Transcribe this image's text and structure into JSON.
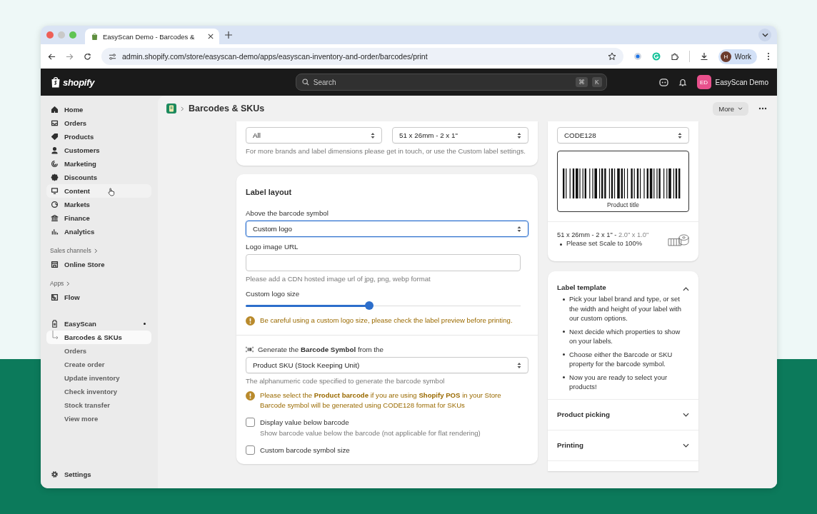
{
  "browser": {
    "tab_title": "EasyScan Demo - Barcodes &",
    "url": "admin.shopify.com/store/easyscan-demo/apps/easyscan-inventory-and-order/barcodes/print",
    "profile": {
      "initial": "H",
      "label": "Work"
    }
  },
  "topbar": {
    "logo_text": "shopify",
    "search": {
      "placeholder": "Search",
      "keys": [
        "⌘",
        "K"
      ]
    },
    "store": {
      "initials": "ED",
      "name": "EasyScan Demo"
    }
  },
  "sidebar": {
    "main_items": [
      {
        "label": "Home",
        "hovered": false
      },
      {
        "label": "Orders",
        "hovered": false
      },
      {
        "label": "Products",
        "hovered": false
      },
      {
        "label": "Customers",
        "hovered": false
      },
      {
        "label": "Marketing",
        "hovered": false
      },
      {
        "label": "Discounts",
        "hovered": false
      },
      {
        "label": "Content",
        "hovered": true
      },
      {
        "label": "Markets",
        "hovered": false
      },
      {
        "label": "Finance",
        "hovered": false
      },
      {
        "label": "Analytics",
        "hovered": false
      }
    ],
    "sales_channels": {
      "label": "Sales channels",
      "items": [
        {
          "label": "Online Store"
        }
      ]
    },
    "apps": {
      "label": "Apps",
      "items": [
        {
          "label": "Flow"
        }
      ]
    },
    "app": {
      "label": "EasyScan",
      "children": [
        {
          "label": "Barcodes & SKUs",
          "selected": true
        },
        {
          "label": "Orders",
          "selected": false
        },
        {
          "label": "Create order",
          "selected": false
        },
        {
          "label": "Update inventory",
          "selected": false
        },
        {
          "label": "Check inventory",
          "selected": false
        },
        {
          "label": "Stock transfer",
          "selected": false
        },
        {
          "label": "View more",
          "selected": false
        }
      ]
    },
    "settings": "Settings"
  },
  "page": {
    "title": "Barcodes & SKUs",
    "more": "More"
  },
  "label_stock": {
    "brand_select": {
      "value": "All",
      "focused": false
    },
    "size_select": {
      "value": "51 x 26mm - 2 x 1\"",
      "focused": false
    },
    "help": "For more brands and label dimensions please get in touch, or use the Custom label settings."
  },
  "label_layout": {
    "title": "Label layout",
    "above_label": "Above the barcode symbol",
    "above_select": {
      "value": "Custom logo",
      "focused": true
    },
    "logo_url_label": "Logo image URL",
    "logo_url_help": "Please add a CDN hosted image url of jpg, png, webp format",
    "logo_size_label": "Custom logo size",
    "logo_size": {
      "level": 0.45
    },
    "warning": "Be careful using a custom logo size, please check the label preview before printing."
  },
  "barcode_symbol": {
    "label": "Generate the **Barcode Symbol** from the",
    "select": {
      "value": "Product SKU (Stock Keeping Unit)",
      "focused": false
    },
    "help": "The alphanumeric code specified to generate the barcode symbol",
    "warnings": [
      "Please select the **Product barcode** if you are using **Shopify POS** in your Store",
      "Barcode symbol will be generated using CODE128 format for SKUs"
    ],
    "options": [
      {
        "label": "Display value below barcode",
        "description": "Show barcode value below the barcode (not applicable for flat rendering)",
        "checked": false
      },
      {
        "label": "Custom barcode symbol size",
        "checked": false
      }
    ]
  },
  "preview": {
    "symbology_select": {
      "value": "CODE128",
      "focused": false
    },
    "caption": "Product title",
    "size": "51 x 26mm - 2 x 1\" - ",
    "size_inches": "2.0\" x 1.0\"",
    "notes": [
      "Please set Scale to 100%"
    ]
  },
  "guide": [
    {
      "title": "Label template",
      "expanded": true,
      "bullets": [
        "Pick your label brand and type, or set the width and height of your label with our custom options.",
        "Next decide which properties to show on your labels.",
        "Choose either the Barcode or SKU property for the barcode symbol.",
        "Now you are ready to select your products!"
      ]
    },
    {
      "title": "Product picking",
      "expanded": false
    },
    {
      "title": "Printing",
      "expanded": false
    }
  ]
}
